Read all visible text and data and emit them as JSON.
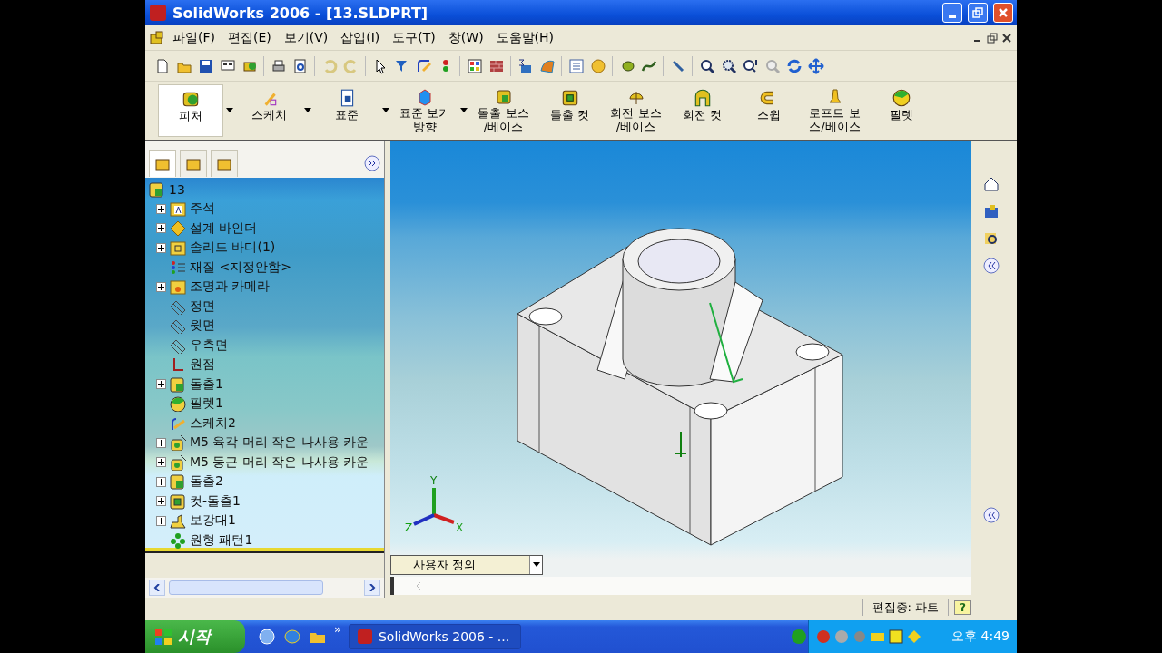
{
  "window": {
    "title": "SolidWorks 2006 - [13.SLDPRT]"
  },
  "menu": [
    "파일(F)",
    "편집(E)",
    "보기(V)",
    "삽입(I)",
    "도구(T)",
    "창(W)",
    "도움말(H)"
  ],
  "command_manager": [
    {
      "lines": [
        "피처"
      ],
      "dropdown": true,
      "selected": true,
      "kind": "feature"
    },
    {
      "lines": [
        "스케치"
      ],
      "dropdown": true,
      "selected": false,
      "kind": "sketch"
    },
    {
      "lines": [
        "표준"
      ],
      "dropdown": true,
      "selected": false,
      "kind": "standard"
    },
    {
      "lines": [
        "표준 보기",
        "방향"
      ],
      "dropdown": true,
      "selected": false,
      "kind": "view"
    },
    {
      "lines": [
        "돌출 보스",
        "/베이스"
      ],
      "dropdown": false,
      "selected": false,
      "kind": "extrude"
    },
    {
      "lines": [
        "돌출 컷"
      ],
      "dropdown": false,
      "selected": false,
      "kind": "cut"
    },
    {
      "lines": [
        "회전 보스",
        "/베이스"
      ],
      "dropdown": false,
      "selected": false,
      "kind": "revolve"
    },
    {
      "lines": [
        "회전 컷"
      ],
      "dropdown": false,
      "selected": false,
      "kind": "revcut"
    },
    {
      "lines": [
        "스윕"
      ],
      "dropdown": false,
      "selected": false,
      "kind": "sweep"
    },
    {
      "lines": [
        "로프트 보",
        "스/베이스"
      ],
      "dropdown": false,
      "selected": false,
      "kind": "loft"
    },
    {
      "lines": [
        "필렛"
      ],
      "dropdown": false,
      "selected": false,
      "kind": "fillet"
    }
  ],
  "feature_tree": {
    "root": "13",
    "items": [
      {
        "label": "주석",
        "kind": "annotation",
        "expandable": true
      },
      {
        "label": "설계 바인더",
        "kind": "binder",
        "expandable": true
      },
      {
        "label": "솔리드 바디(1)",
        "kind": "body",
        "expandable": true
      },
      {
        "label": "재질 <지정안함>",
        "kind": "material",
        "expandable": false
      },
      {
        "label": "조명과 카메라",
        "kind": "lights",
        "expandable": true
      },
      {
        "label": "정면",
        "kind": "plane",
        "expandable": false
      },
      {
        "label": "윗면",
        "kind": "plane",
        "expandable": false
      },
      {
        "label": "우측면",
        "kind": "plane",
        "expandable": false
      },
      {
        "label": "원점",
        "kind": "origin",
        "expandable": false
      },
      {
        "label": "돌출1",
        "kind": "extrude",
        "expandable": true
      },
      {
        "label": "필렛1",
        "kind": "fillet",
        "expandable": false
      },
      {
        "label": "스케치2",
        "kind": "sketch",
        "expandable": false
      },
      {
        "label": "M5 육각 머리 작은 나사용 카운",
        "kind": "hole",
        "expandable": true
      },
      {
        "label": "M5 둥근 머리 작은 나사용 카운",
        "kind": "hole",
        "expandable": true
      },
      {
        "label": "돌출2",
        "kind": "extrude",
        "expandable": true
      },
      {
        "label": "컷-돌출1",
        "kind": "cut",
        "expandable": true
      },
      {
        "label": "보강대1",
        "kind": "rib",
        "expandable": true
      },
      {
        "label": "원형 패턴1",
        "kind": "pattern",
        "expandable": false
      }
    ]
  },
  "viewport": {
    "axes": [
      "Y",
      "Z",
      "X"
    ],
    "view_dropdown": "사용자 정의"
  },
  "status_bar": {
    "mode": "편집중: 파트",
    "help": "?"
  },
  "taskbar": {
    "start": "시작",
    "more": "»",
    "task": "SolidWorks 2006 - ...",
    "clock": "오후 4:49"
  }
}
